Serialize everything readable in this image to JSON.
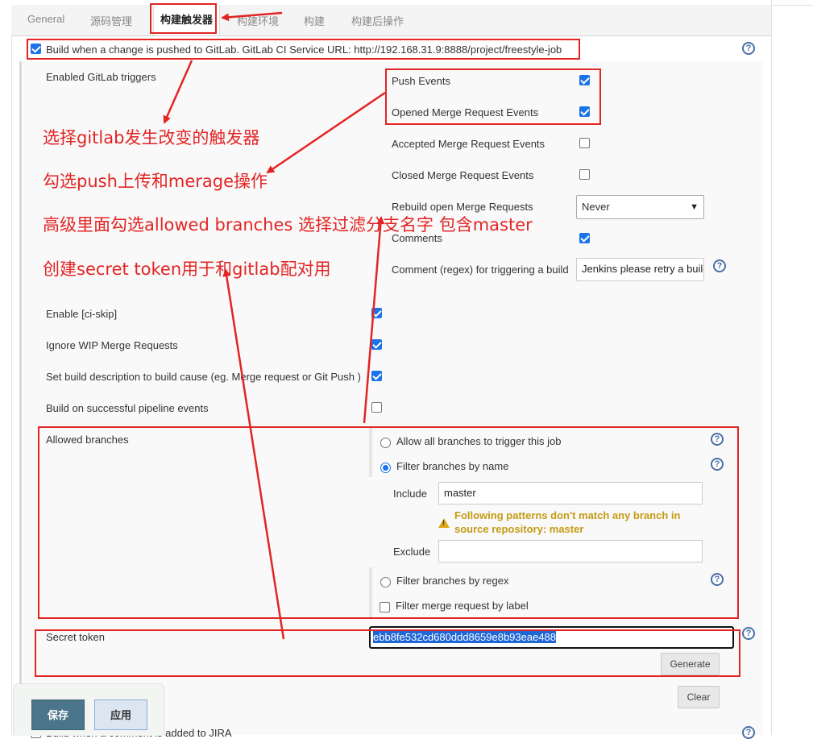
{
  "tabs": [
    "General",
    "源码管理",
    "构建触发器",
    "构建环境",
    "构建",
    "构建后操作"
  ],
  "main_trigger_label": "Build when a change is pushed to GitLab. GitLab CI Service URL: http://192.168.31.9:8888/project/freestyle-job",
  "enabled_triggers_label": "Enabled GitLab triggers",
  "triggers": {
    "push": "Push Events",
    "opened_mr": "Opened Merge Request Events",
    "accepted_mr": "Accepted Merge Request Events",
    "closed_mr": "Closed Merge Request Events",
    "rebuild_open_mr": "Rebuild open Merge Requests",
    "rebuild_select_value": "Never",
    "comments": "Comments",
    "comment_regex": "Comment (regex) for triggering a build",
    "comment_regex_value": "Jenkins please retry a build"
  },
  "options": {
    "ci_skip": "Enable [ci-skip]",
    "ignore_wip": "Ignore WIP Merge Requests",
    "set_description": "Set build description to build cause (eg. Merge request or Git Push )",
    "pipeline_events": "Build on successful pipeline events"
  },
  "branches": {
    "label": "Allowed branches",
    "allow_all": "Allow all branches to trigger this job",
    "filter_by_name": "Filter branches by name",
    "include_label": "Include",
    "include_value": "master",
    "warning": "Following patterns don't match any branch in source repository: master",
    "exclude_label": "Exclude",
    "exclude_value": "",
    "filter_by_regex": "Filter branches by regex",
    "filter_mr_label": "Filter merge request by label"
  },
  "secret": {
    "label": "Secret token",
    "value": "ebb8fe532cd680ddd8659e8b93eae488",
    "generate": "Generate",
    "clear": "Clear"
  },
  "next_trigger_label": "Build when a comment is added to JIRA",
  "footer": {
    "save": "保存",
    "apply": "应用"
  },
  "annotations": [
    "选择gitlab发生改变的触发器",
    "勾选push上传和merage操作",
    "高级里面勾选allowed branches 选择过滤分支名字  包含master",
    "创建secret token用于和gitlab配对用"
  ],
  "help_symbol": "?",
  "colors": {
    "annotation_red": "#e32424",
    "checkbox_blue": "#1a73e8",
    "warning_gold": "#c59b13",
    "save_button": "#4b758b"
  }
}
